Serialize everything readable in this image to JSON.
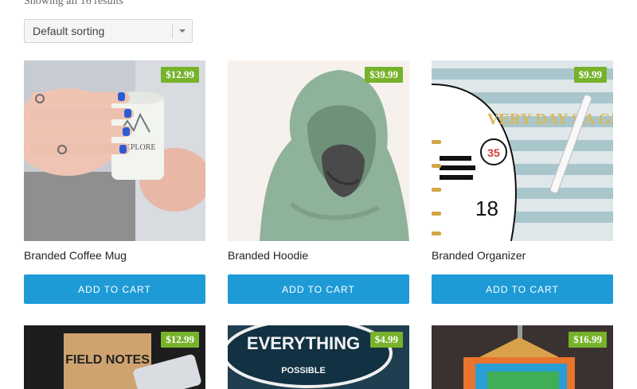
{
  "shop": {
    "results_text": "Showing all 16 results",
    "sort_label": "Default sorting"
  },
  "products": [
    {
      "name": "Branded Coffee Mug",
      "price": "$12.99",
      "button": "ADD TO CART"
    },
    {
      "name": "Branded Hoodie",
      "price": "$39.99",
      "button": "ADD TO CART"
    },
    {
      "name": "Branded Organizer",
      "price": "$9.99",
      "button": "ADD TO CART"
    },
    {
      "name": "",
      "price": "$12.99"
    },
    {
      "name": "",
      "price": "$4.99"
    },
    {
      "name": "",
      "price": "$16.99"
    }
  ],
  "image_text": {
    "notebook": "FIELD NOTES",
    "sticker_top": "EVERYTHING",
    "sticker_bottom": "POSSIBLE",
    "organizer_page": "18",
    "organizer_words": "VERY DAY S A GIFT"
  },
  "colors": {
    "price_badge": "#77b22b",
    "button": "#1e9bd7"
  }
}
